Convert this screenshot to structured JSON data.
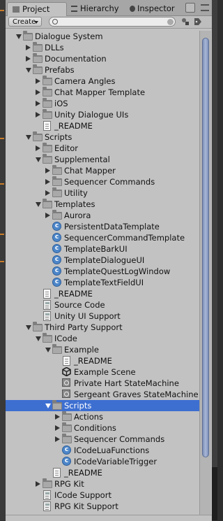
{
  "tabs": {
    "project": "Project",
    "hierarchy": "Hierarchy",
    "inspector": "Inspector"
  },
  "toolbar": {
    "create_label": "Create",
    "search_placeholder": ""
  },
  "colors": {
    "selection": "#3d6fd1",
    "panel_bg": "#c2c2c2",
    "folder": "#7e7e7e",
    "script_icon": "#4d86c9"
  },
  "tree": [
    {
      "label": "Dialogue System",
      "depth": 0,
      "icon": "folder-icon",
      "arrow": "down"
    },
    {
      "label": "DLLs",
      "depth": 1,
      "icon": "folder-icon",
      "arrow": "right"
    },
    {
      "label": "Documentation",
      "depth": 1,
      "icon": "folder-icon",
      "arrow": "right"
    },
    {
      "label": "Prefabs",
      "depth": 1,
      "icon": "folder-icon",
      "arrow": "down"
    },
    {
      "label": "Camera Angles",
      "depth": 2,
      "icon": "folder-icon",
      "arrow": "right"
    },
    {
      "label": "Chat Mapper Template",
      "depth": 2,
      "icon": "folder-icon",
      "arrow": "right"
    },
    {
      "label": "iOS",
      "depth": 2,
      "icon": "folder-icon",
      "arrow": "right"
    },
    {
      "label": "Unity Dialogue UIs",
      "depth": 2,
      "icon": "folder-icon",
      "arrow": "right"
    },
    {
      "label": "_README",
      "depth": 2,
      "icon": "text-file-icon",
      "arrow": "none"
    },
    {
      "label": "Scripts",
      "depth": 1,
      "icon": "folder-icon",
      "arrow": "down"
    },
    {
      "label": "Editor",
      "depth": 2,
      "icon": "folder-icon",
      "arrow": "right"
    },
    {
      "label": "Supplemental",
      "depth": 2,
      "icon": "folder-icon",
      "arrow": "down"
    },
    {
      "label": "Chat Mapper",
      "depth": 3,
      "icon": "folder-icon",
      "arrow": "right"
    },
    {
      "label": "Sequencer Commands",
      "depth": 3,
      "icon": "folder-icon",
      "arrow": "right"
    },
    {
      "label": "Utility",
      "depth": 3,
      "icon": "folder-icon",
      "arrow": "right"
    },
    {
      "label": "Templates",
      "depth": 2,
      "icon": "folder-icon",
      "arrow": "down"
    },
    {
      "label": "Aurora",
      "depth": 3,
      "icon": "folder-icon",
      "arrow": "right"
    },
    {
      "label": "PersistentDataTemplate",
      "depth": 3,
      "icon": "csharp-script-icon",
      "arrow": "none"
    },
    {
      "label": "SequencerCommandTemplate",
      "depth": 3,
      "icon": "csharp-script-icon",
      "arrow": "none"
    },
    {
      "label": "TemplateBarkUI",
      "depth": 3,
      "icon": "csharp-script-icon",
      "arrow": "none"
    },
    {
      "label": "TemplateDialogueUI",
      "depth": 3,
      "icon": "csharp-script-icon",
      "arrow": "none"
    },
    {
      "label": "TemplateQuestLogWindow",
      "depth": 3,
      "icon": "csharp-script-icon",
      "arrow": "none"
    },
    {
      "label": "TemplateTextFieldUI",
      "depth": 3,
      "icon": "csharp-script-icon",
      "arrow": "none"
    },
    {
      "label": "_README",
      "depth": 2,
      "icon": "text-file-icon",
      "arrow": "none"
    },
    {
      "label": "Source Code",
      "depth": 2,
      "icon": "package-icon",
      "arrow": "none"
    },
    {
      "label": "Unity UI Support",
      "depth": 2,
      "icon": "package-icon",
      "arrow": "none"
    },
    {
      "label": "Third Party Support",
      "depth": 1,
      "icon": "folder-icon",
      "arrow": "down"
    },
    {
      "label": "ICode",
      "depth": 2,
      "icon": "folder-icon",
      "arrow": "down"
    },
    {
      "label": "Example",
      "depth": 3,
      "icon": "folder-icon",
      "arrow": "down"
    },
    {
      "label": "_README",
      "depth": 4,
      "icon": "text-file-icon",
      "arrow": "none"
    },
    {
      "label": "Example Scene",
      "depth": 4,
      "icon": "unity-scene-icon",
      "arrow": "none"
    },
    {
      "label": "Private Hart StateMachine",
      "depth": 4,
      "icon": "state-machine-icon",
      "arrow": "none"
    },
    {
      "label": "Sergeant Graves StateMachine",
      "depth": 4,
      "icon": "state-machine-icon",
      "arrow": "none"
    },
    {
      "label": "Scripts",
      "depth": 3,
      "icon": "folder-icon",
      "arrow": "down",
      "selected": true
    },
    {
      "label": "Actions",
      "depth": 4,
      "icon": "folder-icon",
      "arrow": "right"
    },
    {
      "label": "Conditions",
      "depth": 4,
      "icon": "folder-icon",
      "arrow": "right"
    },
    {
      "label": "Sequencer Commands",
      "depth": 4,
      "icon": "folder-icon",
      "arrow": "right"
    },
    {
      "label": "ICodeLuaFunctions",
      "depth": 4,
      "icon": "csharp-script-icon",
      "arrow": "none"
    },
    {
      "label": "ICodeVariableTrigger",
      "depth": 4,
      "icon": "csharp-script-icon",
      "arrow": "none"
    },
    {
      "label": "_README",
      "depth": 3,
      "icon": "text-file-icon",
      "arrow": "none"
    },
    {
      "label": "RPG Kit",
      "depth": 2,
      "icon": "folder-icon",
      "arrow": "right"
    },
    {
      "label": "ICode Support",
      "depth": 2,
      "icon": "package-icon",
      "arrow": "none"
    },
    {
      "label": "RPG Kit Support",
      "depth": 2,
      "icon": "package-icon",
      "arrow": "none"
    }
  ]
}
